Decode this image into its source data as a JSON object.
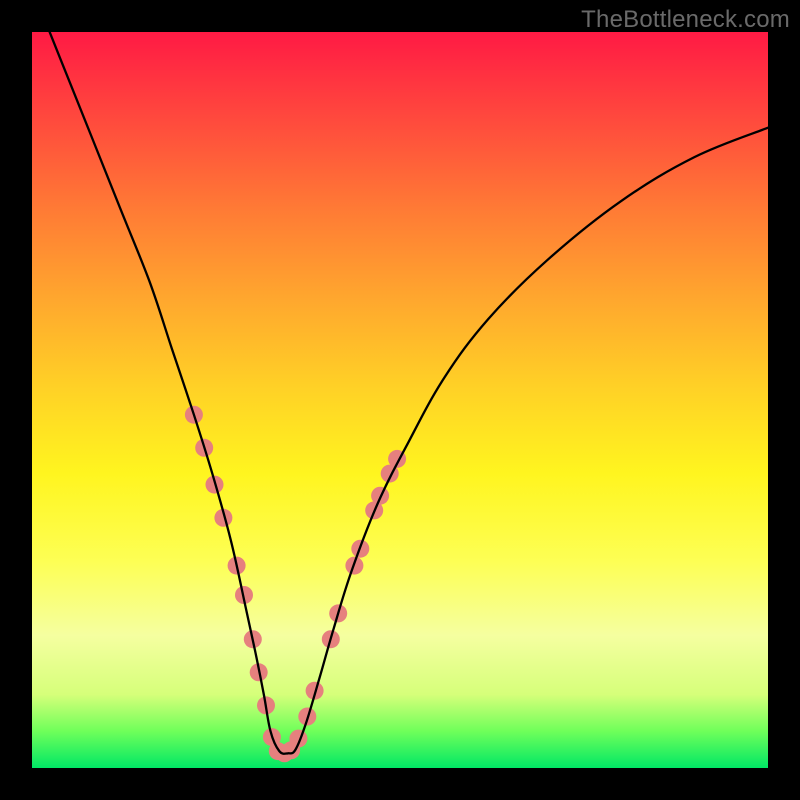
{
  "watermark": {
    "text": "TheBottleneck.com"
  },
  "chart_data": {
    "type": "line",
    "title": "",
    "xlabel": "",
    "ylabel": "",
    "xlim": [
      0,
      100
    ],
    "ylim": [
      0,
      100
    ],
    "grid": false,
    "legend": false,
    "background_gradient": {
      "direction": "vertical",
      "stops": [
        {
          "pos": 0.0,
          "color": "#ff1a44"
        },
        {
          "pos": 0.5,
          "color": "#ffd026"
        },
        {
          "pos": 0.8,
          "color": "#fdff55"
        },
        {
          "pos": 1.0,
          "color": "#00e765"
        }
      ]
    },
    "series": [
      {
        "name": "bottleneck-curve",
        "stroke": "#000000",
        "stroke_width": 2.3,
        "x": [
          0,
          4,
          8,
          12,
          16,
          19,
          22,
          24.5,
          27,
          29,
          30.5,
          31.5,
          32.4,
          33.6,
          34.8,
          35.8,
          37.2,
          39,
          41,
          43.5,
          47,
          51,
          56,
          62,
          70,
          80,
          90,
          100
        ],
        "y": [
          106,
          96,
          86,
          76,
          66,
          57,
          48,
          40,
          31,
          22,
          15,
          10,
          5,
          2.3,
          2.0,
          2.5,
          6,
          12,
          19,
          27,
          36,
          44,
          53,
          61,
          69,
          77,
          83,
          87
        ]
      }
    ],
    "markers": {
      "name": "highlighted-points",
      "fill": "#e6807e",
      "radius": 9,
      "points": [
        {
          "x": 22.0,
          "y": 48.0
        },
        {
          "x": 23.4,
          "y": 43.5
        },
        {
          "x": 24.8,
          "y": 38.5
        },
        {
          "x": 26.0,
          "y": 34.0
        },
        {
          "x": 27.8,
          "y": 27.5
        },
        {
          "x": 28.8,
          "y": 23.5
        },
        {
          "x": 30.0,
          "y": 17.5
        },
        {
          "x": 30.8,
          "y": 13.0
        },
        {
          "x": 31.8,
          "y": 8.5
        },
        {
          "x": 32.6,
          "y": 4.2
        },
        {
          "x": 33.4,
          "y": 2.3
        },
        {
          "x": 34.3,
          "y": 2.0
        },
        {
          "x": 35.2,
          "y": 2.4
        },
        {
          "x": 36.2,
          "y": 4.0
        },
        {
          "x": 37.4,
          "y": 7.0
        },
        {
          "x": 38.4,
          "y": 10.5
        },
        {
          "x": 40.6,
          "y": 17.5
        },
        {
          "x": 41.6,
          "y": 21.0
        },
        {
          "x": 43.8,
          "y": 27.5
        },
        {
          "x": 44.6,
          "y": 29.8
        },
        {
          "x": 46.5,
          "y": 35.0
        },
        {
          "x": 47.3,
          "y": 37.0
        },
        {
          "x": 48.6,
          "y": 40.0
        },
        {
          "x": 49.6,
          "y": 42.0
        }
      ]
    }
  }
}
